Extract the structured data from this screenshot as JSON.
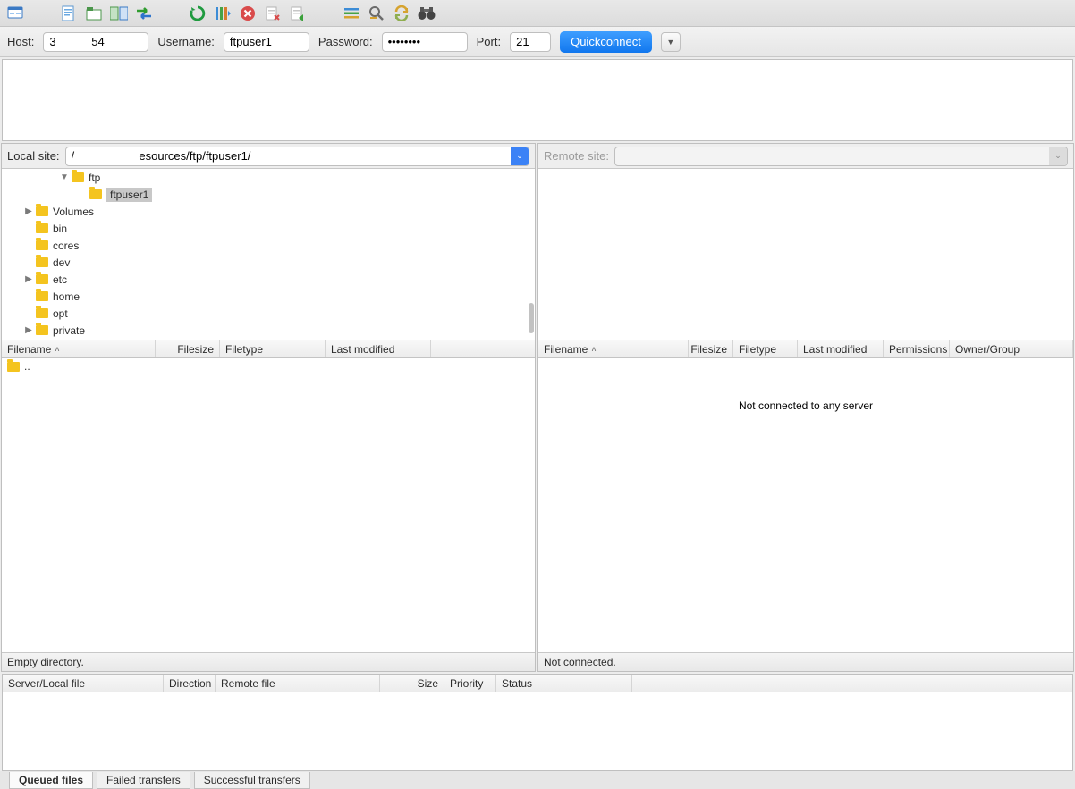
{
  "toolbar": {
    "icons": [
      "site-manager-icon",
      "",
      "file-icon",
      "new-tab-icon",
      "compare-icon",
      "transfer-icon",
      "",
      "refresh-icon",
      "process-queue-icon",
      "cancel-icon",
      "disconnect-icon",
      "reconnect-icon",
      "",
      "filter-icon",
      "search-icon",
      "sync-icon",
      "binoculars-icon"
    ]
  },
  "quickconnect": {
    "host_label": "Host:",
    "host_value": "3           54",
    "user_label": "Username:",
    "user_value": "ftpuser1",
    "pass_label": "Password:",
    "pass_value": "••••••••",
    "port_label": "Port:",
    "port_value": "21",
    "button": "Quickconnect"
  },
  "local": {
    "label": "Local site:",
    "path": "/                    esources/ftp/ftpuser1/",
    "tree": [
      {
        "indent": 64,
        "toggle": "▼",
        "name": "ftp",
        "sel": false
      },
      {
        "indent": 84,
        "toggle": "",
        "name": "ftpuser1",
        "sel": true
      },
      {
        "indent": 24,
        "toggle": "▶",
        "name": "Volumes",
        "sel": false
      },
      {
        "indent": 24,
        "toggle": "",
        "name": "bin",
        "sel": false
      },
      {
        "indent": 24,
        "toggle": "",
        "name": "cores",
        "sel": false
      },
      {
        "indent": 24,
        "toggle": "",
        "name": "dev",
        "sel": false
      },
      {
        "indent": 24,
        "toggle": "▶",
        "name": "etc",
        "sel": false
      },
      {
        "indent": 24,
        "toggle": "",
        "name": "home",
        "sel": false
      },
      {
        "indent": 24,
        "toggle": "",
        "name": "opt",
        "sel": false
      },
      {
        "indent": 24,
        "toggle": "▶",
        "name": "private",
        "sel": false
      }
    ],
    "headers": {
      "filename": "Filename",
      "filesize": "Filesize",
      "filetype": "Filetype",
      "modified": "Last modified"
    },
    "parent_row": "..",
    "status": "Empty directory."
  },
  "remote": {
    "label": "Remote site:",
    "headers": {
      "filename": "Filename",
      "filesize": "Filesize",
      "filetype": "Filetype",
      "modified": "Last modified",
      "permissions": "Permissions",
      "owner": "Owner/Group"
    },
    "message": "Not connected to any server",
    "status": "Not connected."
  },
  "queue": {
    "headers": {
      "server": "Server/Local file",
      "direction": "Direction",
      "remote": "Remote file",
      "size": "Size",
      "priority": "Priority",
      "status": "Status"
    }
  },
  "tabs": {
    "queued": "Queued files",
    "failed": "Failed transfers",
    "success": "Successful transfers"
  }
}
